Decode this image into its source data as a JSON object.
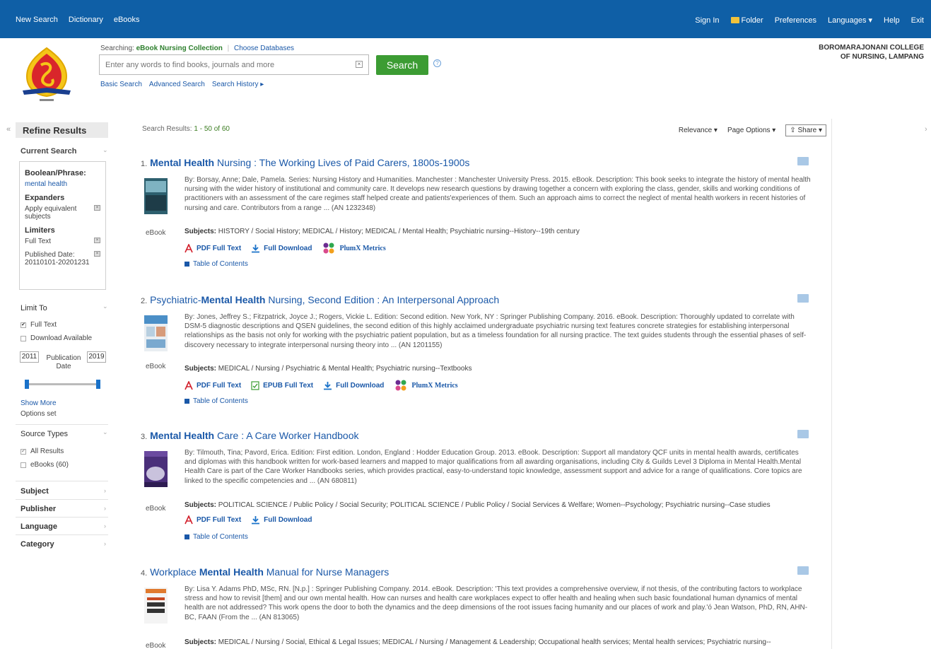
{
  "topnav": {
    "left": [
      "New Search",
      "Dictionary",
      "eBooks"
    ],
    "sign_in": "Sign In",
    "folder": "Folder",
    "preferences": "Preferences",
    "languages": "Languages ▾",
    "help": "Help",
    "exit": "Exit"
  },
  "header": {
    "searching_label": "Searching:",
    "database": "eBook Nursing Collection",
    "choose_databases": "Choose Databases",
    "search_placeholder": "Enter any words to find books, journals and more",
    "search_button": "Search",
    "basic_search": "Basic Search",
    "advanced_search": "Advanced Search",
    "search_history": "Search History ▸",
    "institution": "BOROMARAJONANI COLLEGE OF NURSING, LAMPANG"
  },
  "sidebar": {
    "refine_title": "Refine Results",
    "current_search": "Current Search",
    "boolean_label": "Boolean/Phrase:",
    "boolean_value": "mental health",
    "expanders_label": "Expanders",
    "expander_item": "Apply equivalent subjects",
    "limiters_label": "Limiters",
    "limiter_fulltext": "Full Text",
    "limiter_pubdate": "Published Date: 20110101-20201231",
    "limit_to": "Limit To",
    "full_text": "Full Text",
    "download_available": "Download Available",
    "year_from": "2011",
    "year_to": "2019",
    "publication_date": "Publication Date",
    "show_more": "Show More",
    "options_set": "Options set",
    "source_types": "Source Types",
    "all_results": "All Results",
    "ebooks": "eBooks (60)",
    "facets": [
      "Subject",
      "Publisher",
      "Language",
      "Category"
    ]
  },
  "main": {
    "results_label": "Search Results:",
    "results_range": "1 - 50 of 60",
    "relevance": "Relevance ▾",
    "page_options": "Page Options ▾",
    "share": "Share ▾"
  },
  "labels": {
    "ebook": "eBook",
    "subjects": "Subjects:",
    "pdf": "PDF Full Text",
    "epub": "EPUB Full Text",
    "download": "Full Download",
    "plumx": "PlumX Metrics",
    "toc": "Table of Contents"
  },
  "results": [
    {
      "num": "1.",
      "title_a": "",
      "title_b": "Mental Health",
      "title_c": " Nursing : The Working Lives of Paid Carers, 1800s-1900s",
      "desc": "By: Borsay, Anne; Dale, Pamela. Series: Nursing History and Humanities. Manchester : Manchester University Press. 2015. eBook. Description: This book seeks to integrate the history of mental health nursing with the wider history of institutional and community care. It develops new research questions by drawing together a concern with exploring the class, gender, skills and working conditions of practitioners with an assessment of the care regimes staff helped create and patients'experiences of them. Such an approach aims to correct the neglect of mental health workers in recent histories of nursing and care. Contributors from a range ... (AN 1232348)",
      "subjects": "HISTORY / Social History; MEDICAL / History; MEDICAL / Mental Health; Psychiatric nursing--History--19th century"
    },
    {
      "num": "2.",
      "title_a": "Psychiatric-",
      "title_b": "Mental Health",
      "title_c": " Nursing, Second Edition : An Interpersonal Approach",
      "desc": "By: Jones, Jeffrey S.; Fitzpatrick, Joyce J.; Rogers, Vickie L. Edition: Second edition. New York, NY : Springer Publishing Company. 2016. eBook. Description: Thoroughly updated to correlate with DSM-5 diagnostic descriptions and QSEN guidelines, the second edition of this highly acclaimed undergraduate psychiatric nursing text features concrete strategies for establishing interpersonal relationships as the basis not only for working with the psychiatric patient population, but as a timeless foundation for all nursing practice. The text guides students through the essential phases of self-discovery necessary to integrate interpersonal nursing theory into ... (AN 1201155)",
      "subjects": "MEDICAL / Nursing / Psychiatric & Mental Health; Psychiatric nursing--Textbooks"
    },
    {
      "num": "3.",
      "title_a": "",
      "title_b": "Mental Health",
      "title_c": " Care : A Care Worker Handbook",
      "desc": "By: Tilmouth, Tina; Pavord, Erica. Edition: First edition. London, England : Hodder Education Group. 2013. eBook. Description: Support all mandatory QCF units in mental health awards, certificates and diplomas with this handbook written for work-based learners and mapped to major qualifications from all awarding organisations, including City & Guilds Level 3 Diploma in Mental Health.Mental Health Care is part of the Care Worker Handbooks series, which provides practical, easy-to-understand topic knowledge, assessment support and advice for a range of qualifications. Core topics are linked to the specific competencies and ... (AN 680811)",
      "subjects": "POLITICAL SCIENCE / Public Policy / Social Security; POLITICAL SCIENCE / Public Policy / Social Services & Welfare; Women--Psychology; Psychiatric nursing--Case studies"
    },
    {
      "num": "4.",
      "title_a": "Workplace ",
      "title_b": "Mental Health",
      "title_c": " Manual for Nurse Managers",
      "desc": "By: Lisa Y. Adams PhD, MSc, RN. [N.p.] : Springer Publishing Company. 2014. eBook. Description: 'This text provides a comprehensive overview, if not thesis, of the contributing factors to workplace stress and how to revisit [them] and our own mental health. How can nurses and health care workplaces expect to offer health and healing when such basic foundational human dynamics of mental health are not addressed? This work opens the door to both the dynamics and the deep dimensions of the root issues facing humanity and our places of work and play.'ó Jean Watson, PhD, RN, AHN-BC, FAAN (From the ... (AN 813065)",
      "subjects": "MEDICAL / Nursing / Social, Ethical & Legal Issues; MEDICAL / Nursing / Management & Leadership; Occupational health services; Mental health services; Psychiatric nursing--"
    }
  ]
}
